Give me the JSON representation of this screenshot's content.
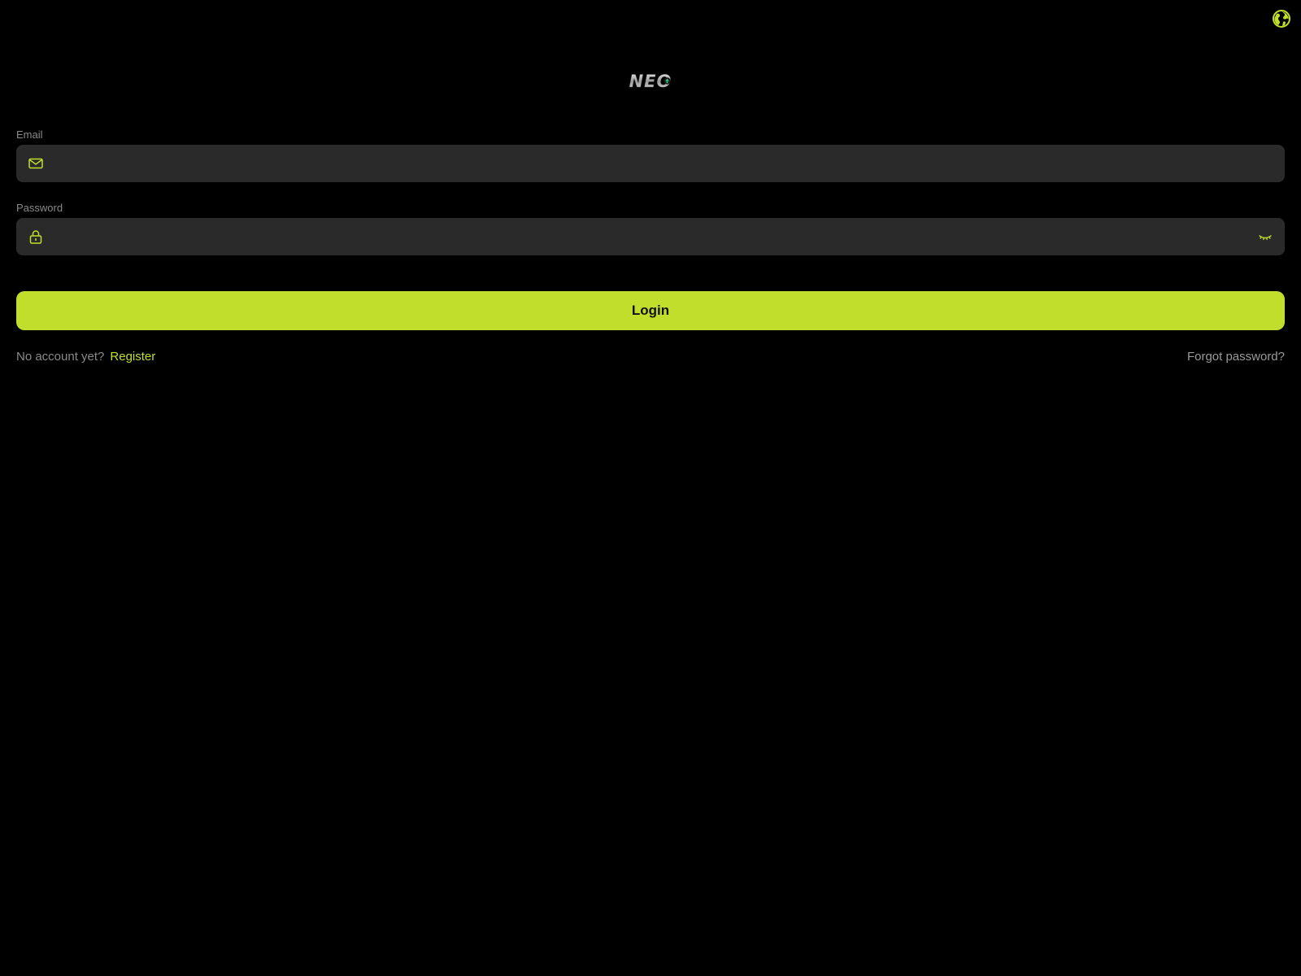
{
  "colors": {
    "accent": "#c2de2c",
    "background": "#000000",
    "field_bg": "#2a2a2a",
    "label": "#8a8a8a"
  },
  "header": {
    "language_icon": "globe-icon",
    "logo_text": "NEO"
  },
  "form": {
    "email": {
      "label": "Email",
      "value": "",
      "placeholder": "",
      "icon": "mail-icon"
    },
    "password": {
      "label": "Password",
      "value": "",
      "placeholder": "",
      "icon": "lock-icon",
      "toggle_icon": "eye-closed-icon"
    },
    "login_label": "Login"
  },
  "footer": {
    "no_account_text": "No account yet?",
    "register_label": "Register",
    "forgot_label": "Forgot password?"
  }
}
